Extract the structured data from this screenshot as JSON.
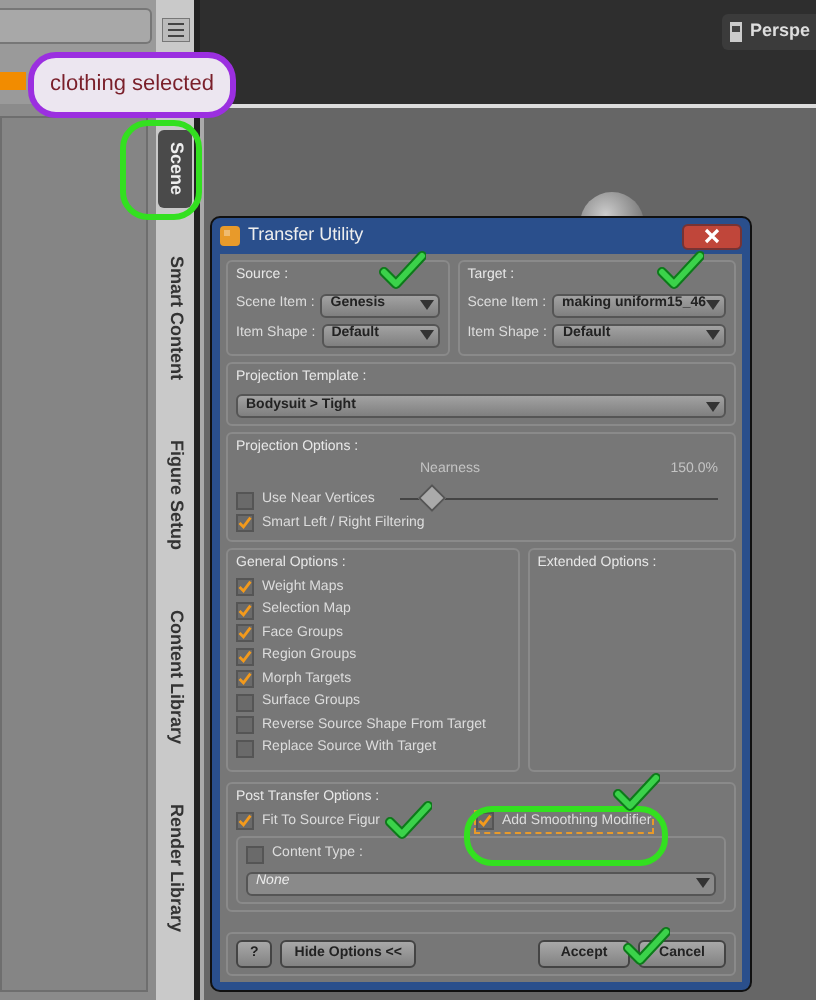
{
  "annotation": {
    "callout": "clothing selected"
  },
  "side_tabs": [
    {
      "label": "Scene",
      "selected": true
    },
    {
      "label": "Smart Content",
      "selected": false
    },
    {
      "label": "Figure Setup",
      "selected": false
    },
    {
      "label": "Content Library",
      "selected": false
    },
    {
      "label": "Render Library",
      "selected": false
    }
  ],
  "viewport": {
    "camera_button": "Perspe"
  },
  "dialog": {
    "title": "Transfer Utility",
    "source": {
      "title": "Source :",
      "scene_item_label": "Scene Item :",
      "scene_item": "Genesis",
      "item_shape_label": "Item Shape :",
      "item_shape": "Default"
    },
    "target": {
      "title": "Target :",
      "scene_item_label": "Scene Item :",
      "scene_item": "making uniform15_46",
      "item_shape_label": "Item Shape :",
      "item_shape": "Default"
    },
    "projection_template": {
      "title": "Projection Template :",
      "value": "Bodysuit > Tight"
    },
    "projection_options": {
      "title": "Projection Options :",
      "use_near_vertices": {
        "label": "Use Near Vertices",
        "checked": false
      },
      "nearness": {
        "label": "Nearness",
        "reading": "150.0%",
        "level": 0.1,
        "disabled": true
      },
      "smart_filtering": {
        "label": "Smart Left / Right Filtering",
        "checked": true
      }
    },
    "general_options": {
      "title": "General Options :",
      "items": [
        {
          "label": "Weight Maps",
          "checked": true
        },
        {
          "label": "Selection Map",
          "checked": true
        },
        {
          "label": "Face Groups",
          "checked": true
        },
        {
          "label": "Region Groups",
          "checked": true
        },
        {
          "label": "Morph Targets",
          "checked": true
        },
        {
          "label": "Surface Groups",
          "checked": false
        },
        {
          "label": "Reverse Source Shape From Target",
          "checked": false
        },
        {
          "label": "Replace Source With Target",
          "checked": false
        }
      ]
    },
    "extended_options": {
      "title": "Extended Options :"
    },
    "post_transfer": {
      "title": "Post Transfer Options :",
      "fit": {
        "label": "Fit To Source Figur",
        "checked": true
      },
      "smoothing": {
        "label": "Add Smoothing Modifier",
        "checked": true
      },
      "content_type": {
        "label": "Content Type :",
        "checked": false
      },
      "content_value": {
        "value": "None",
        "disabled": true
      }
    },
    "buttons": {
      "help": "?",
      "hide": "Hide Options <<",
      "accept": "Accept",
      "cancel": "Cancel"
    }
  }
}
